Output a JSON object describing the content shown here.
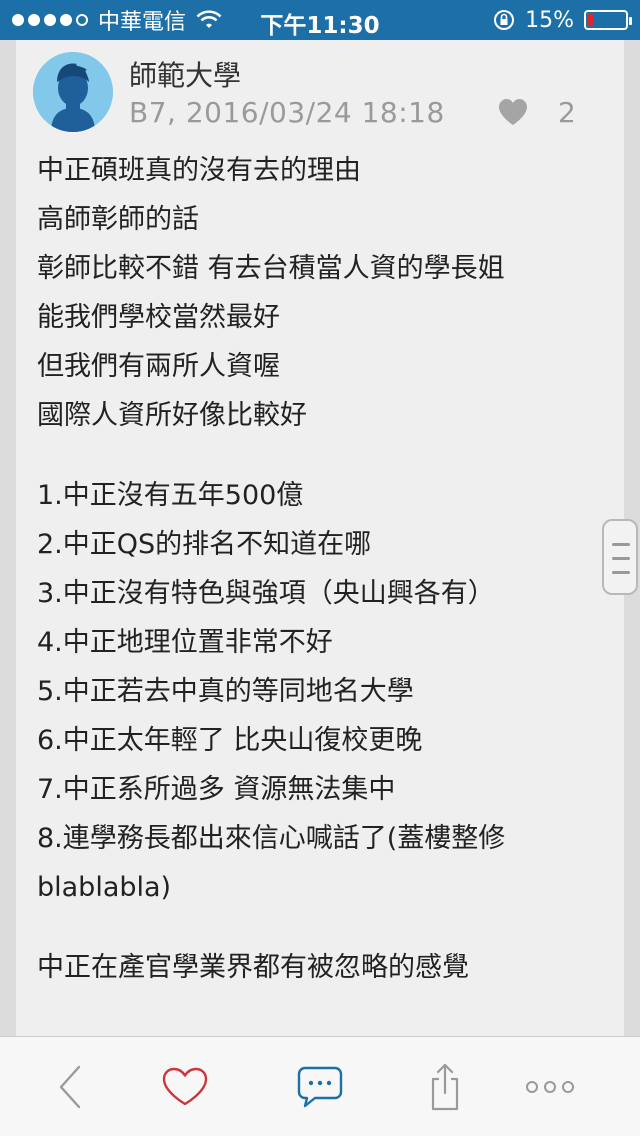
{
  "status_bar": {
    "carrier": "中華電信",
    "time": "下午11:30",
    "battery_text": "15%",
    "battery_level": 0.15,
    "signal_bars": 4
  },
  "post": {
    "author": "師範大學",
    "meta": "B7, 2016/03/24 18:18",
    "like_count": "2",
    "lines": [
      "中正碩班真的沒有去的理由",
      "高師彰師的話",
      "彰師比較不錯 有去台積當人資的學長姐",
      "能我們學校當然最好",
      "但我們有兩所人資喔",
      "國際人資所好像比較好",
      "",
      "1.中正沒有五年500億",
      "2.中正QS的排名不知道在哪",
      "3.中正沒有特色與強項（央山興各有）",
      "4.中正地理位置非常不好",
      "5.中正若去中真的等同地名大學",
      "6.中正太年輕了 比央山復校更晚",
      "7.中正系所過多 資源無法集中",
      "8.連學務長都出來信心喊話了(蓋樓整修",
      "blablabla)",
      "",
      "中正在產官學業界都有被忽略的感覺"
    ]
  },
  "toolbar": {
    "icons": [
      "back-icon",
      "heart-icon",
      "comment-icon",
      "share-icon",
      "more-icon"
    ]
  },
  "colors": {
    "status_bar": "#1d6fa8",
    "accent": "#1d6fa8",
    "heart": "#c9383a",
    "battery_low": "#e0262b"
  }
}
